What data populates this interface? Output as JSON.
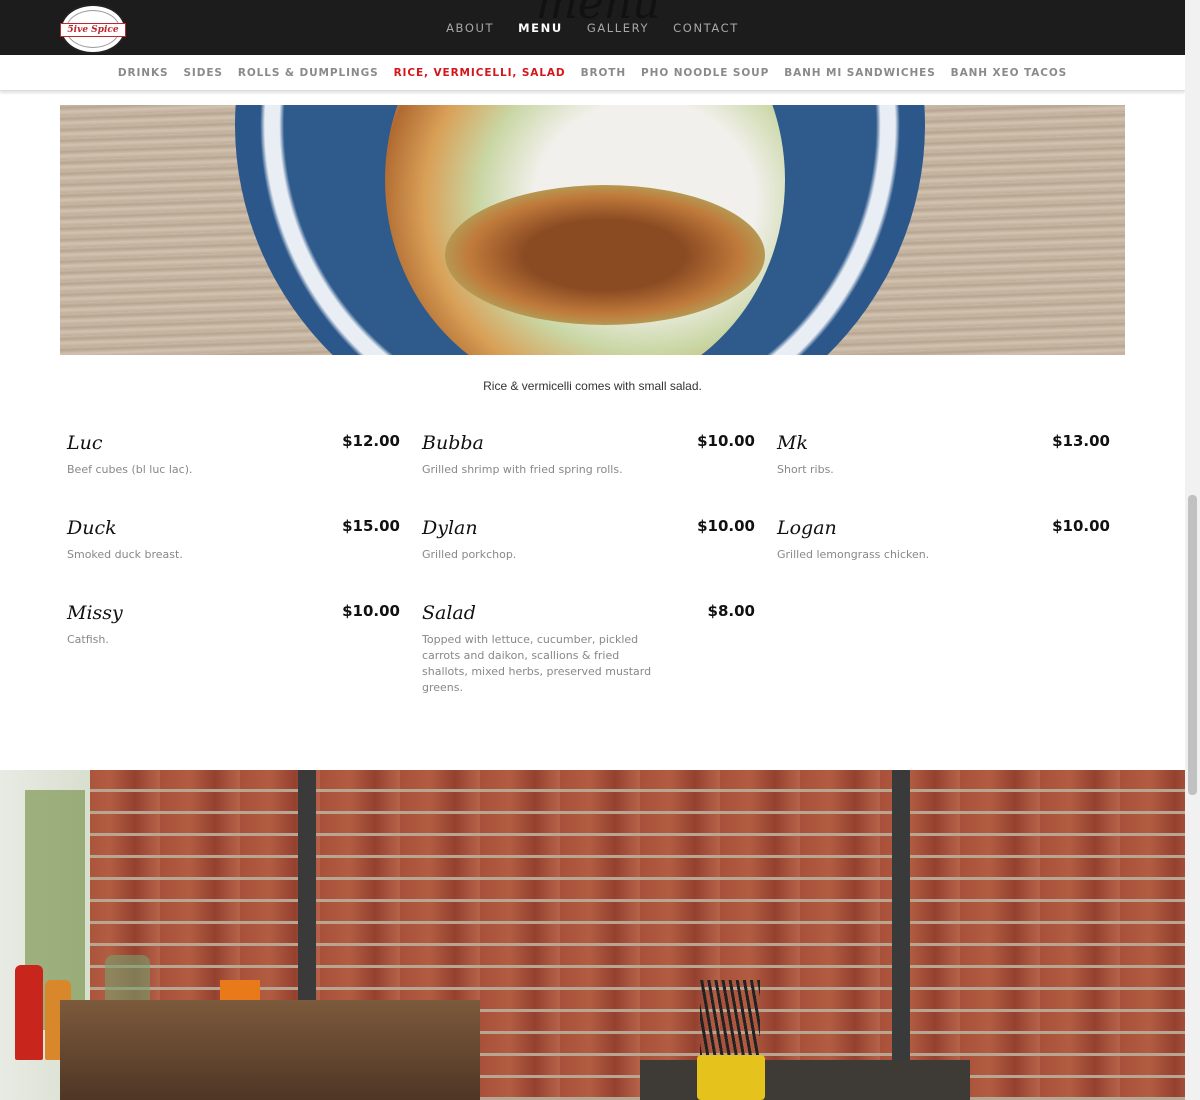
{
  "header": {
    "logo_text": "5ive Spice",
    "behind_title": "menu",
    "nav": [
      "ABOUT",
      "MENU",
      "GALLERY",
      "CONTACT"
    ],
    "nav_active": "MENU"
  },
  "subnav": {
    "items": [
      "DRINKS",
      "SIDES",
      "ROLLS & DUMPLINGS",
      "RICE, VERMICELLI, SALAD",
      "BROTH",
      "PHO NOODLE SOUP",
      "BANH MI SANDWICHES",
      "BANH XEO TACOS"
    ],
    "active": "RICE, VERMICELLI, SALAD"
  },
  "section": {
    "caption": "Rice & vermicelli comes with small salad.",
    "items": [
      {
        "name": "Luc",
        "price": "$12.00",
        "desc": "Beef cubes (bl luc lac)."
      },
      {
        "name": "Bubba",
        "price": "$10.00",
        "desc": "Grilled shrimp with fried spring rolls."
      },
      {
        "name": "Mk",
        "price": "$13.00",
        "desc": "Short ribs."
      },
      {
        "name": "Duck",
        "price": "$15.00",
        "desc": "Smoked duck breast."
      },
      {
        "name": "Dylan",
        "price": "$10.00",
        "desc": "Grilled porkchop."
      },
      {
        "name": "Logan",
        "price": "$10.00",
        "desc": "Grilled lemongrass chicken."
      },
      {
        "name": "Missy",
        "price": "$10.00",
        "desc": "Catfish."
      },
      {
        "name": "Salad",
        "price": "$8.00",
        "desc": "Topped with lettuce, cucumber, pickled carrots and daikon, scallions & fried shallots, mixed herbs, preserved mustard greens."
      }
    ]
  },
  "colors": {
    "accent": "#d4161d",
    "topbar": "#1c1c1c"
  }
}
